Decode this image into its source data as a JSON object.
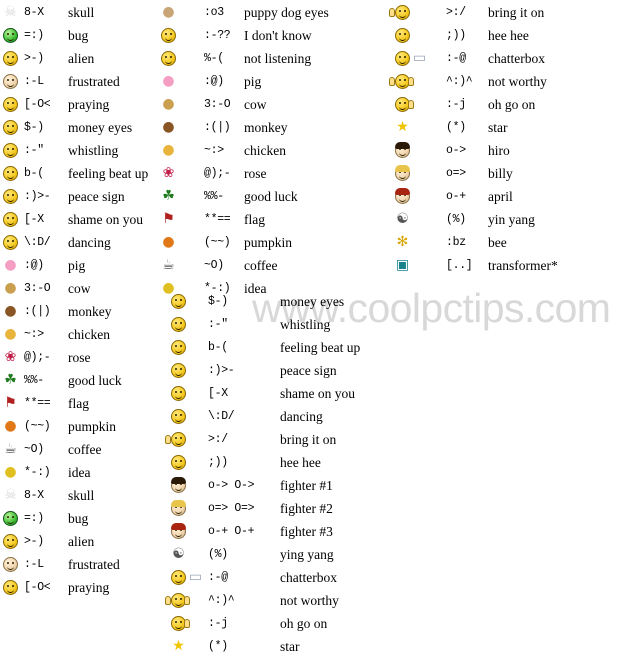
{
  "watermark": "www.coolpctips.com",
  "columns": {
    "a": {
      "name": "left-column",
      "rows": [
        {
          "icon": "skull-emoticon",
          "code": "8-X",
          "label": "skull"
        },
        {
          "icon": "bug-emoticon",
          "code": "=:)",
          "label": "bug"
        },
        {
          "icon": "alien-emoticon",
          "code": ">-)",
          "label": "alien"
        },
        {
          "icon": "frustrated-emoticon",
          "code": ":-L",
          "label": "frustrated"
        },
        {
          "icon": "praying-emoticon",
          "code": "[-O<",
          "label": "praying"
        },
        {
          "icon": "money-eyes-emoticon",
          "code": "$-)",
          "label": "money eyes"
        },
        {
          "icon": "whistling-emoticon",
          "code": ":-\"",
          "label": "whistling"
        },
        {
          "icon": "feeling-beat-up-emoticon",
          "code": "b-(",
          "label": "feeling beat up"
        },
        {
          "icon": "peace-sign-emoticon",
          "code": ":)>-",
          "label": "peace sign"
        },
        {
          "icon": "shame-on-you-emoticon",
          "code": "[-X",
          "label": "shame on you"
        },
        {
          "icon": "dancing-emoticon",
          "code": "\\:D/",
          "label": "dancing"
        },
        {
          "icon": "pig-emoticon",
          "code": ":@)",
          "label": "pig"
        },
        {
          "icon": "cow-emoticon",
          "code": "3:-O",
          "label": "cow"
        },
        {
          "icon": "monkey-emoticon",
          "code": ":(|)",
          "label": "monkey"
        },
        {
          "icon": "chicken-emoticon",
          "code": "~:>",
          "label": "chicken"
        },
        {
          "icon": "rose-emoticon",
          "code": "@);-",
          "label": "rose"
        },
        {
          "icon": "good-luck-emoticon",
          "code": "%%-",
          "label": "good luck"
        },
        {
          "icon": "flag-emoticon",
          "code": "**==",
          "label": "flag"
        },
        {
          "icon": "pumpkin-emoticon",
          "code": "(~~)",
          "label": "pumpkin"
        },
        {
          "icon": "coffee-emoticon",
          "code": "~O)",
          "label": "coffee"
        },
        {
          "icon": "idea-emoticon",
          "code": "*-:)",
          "label": "idea"
        },
        {
          "icon": "skull-emoticon",
          "code": "8-X",
          "label": "skull"
        },
        {
          "icon": "bug-emoticon",
          "code": "=:)",
          "label": "bug"
        },
        {
          "icon": "alien-emoticon",
          "code": ">-)",
          "label": "alien"
        },
        {
          "icon": "frustrated-emoticon",
          "code": ":-L",
          "label": "frustrated"
        },
        {
          "icon": "praying-emoticon",
          "code": "[-O<",
          "label": "praying"
        }
      ]
    },
    "b": {
      "name": "second-column",
      "rows": [
        {
          "icon": "puppy-dog-eyes-emoticon",
          "code": ":o3",
          "label": "puppy dog eyes"
        },
        {
          "icon": "i-dont-know-emoticon",
          "code": ":-??",
          "label": "I don't know"
        },
        {
          "icon": "not-listening-emoticon",
          "code": "%-(",
          "label": "not listening"
        },
        {
          "icon": "pig-emoticon",
          "code": ":@)",
          "label": "pig"
        },
        {
          "icon": "cow-emoticon",
          "code": "3:-O",
          "label": "cow"
        },
        {
          "icon": "monkey-emoticon",
          "code": ":(|)",
          "label": "monkey"
        },
        {
          "icon": "chicken-emoticon",
          "code": "~:>",
          "label": "chicken"
        },
        {
          "icon": "rose-emoticon",
          "code": "@);-",
          "label": "rose"
        },
        {
          "icon": "good-luck-emoticon",
          "code": "%%-",
          "label": "good luck"
        },
        {
          "icon": "flag-emoticon",
          "code": "**==",
          "label": "flag"
        },
        {
          "icon": "pumpkin-emoticon",
          "code": "(~~)",
          "label": "pumpkin"
        },
        {
          "icon": "coffee-emoticon",
          "code": "~O)",
          "label": "coffee"
        },
        {
          "icon": "idea-emoticon",
          "code": "*-:)",
          "label": "idea"
        }
      ]
    },
    "c": {
      "name": "third-column",
      "rows": [
        {
          "icon": "money-eyes-emoticon",
          "code": "$-)",
          "label": "money eyes"
        },
        {
          "icon": "whistling-emoticon",
          "code": ":-\"",
          "label": "whistling"
        },
        {
          "icon": "feeling-beat-up-emoticon",
          "code": "b-(",
          "label": "feeling beat up"
        },
        {
          "icon": "peace-sign-emoticon",
          "code": ":)>-",
          "label": "peace sign"
        },
        {
          "icon": "shame-on-you-emoticon",
          "code": "[-X",
          "label": "shame on you"
        },
        {
          "icon": "dancing-emoticon",
          "code": "\\:D/",
          "label": "dancing"
        },
        {
          "icon": "bring-it-on-emoticon",
          "code": ">:/",
          "label": "bring it on"
        },
        {
          "icon": "hee-hee-emoticon",
          "code": ";))",
          "label": "hee hee"
        },
        {
          "icon": "fighter-1-emoticon",
          "code": "o-> O->",
          "label": "fighter #1"
        },
        {
          "icon": "fighter-2-emoticon",
          "code": "o=> O=>",
          "label": "fighter #2"
        },
        {
          "icon": "fighter-3-emoticon",
          "code": "o-+ O-+",
          "label": "fighter #3"
        },
        {
          "icon": "ying-yang-emoticon",
          "code": "(%)",
          "label": "ying yang"
        },
        {
          "icon": "chatterbox-emoticon",
          "code": ":-@",
          "label": "chatterbox"
        },
        {
          "icon": "not-worthy-emoticon",
          "code": "^:)^",
          "label": "not worthy"
        },
        {
          "icon": "oh-go-on-emoticon",
          "code": ":-j",
          "label": "oh go on"
        },
        {
          "icon": "star-emoticon",
          "code": "(*)",
          "label": "star"
        }
      ]
    },
    "d": {
      "name": "right-column",
      "rows": [
        {
          "icon": "bring-it-on-emoticon",
          "code": ">:/",
          "label": "bring it on"
        },
        {
          "icon": "hee-hee-emoticon",
          "code": ";))",
          "label": "hee hee"
        },
        {
          "icon": "chatterbox-emoticon",
          "code": ":-@",
          "label": "chatterbox"
        },
        {
          "icon": "not-worthy-emoticon",
          "code": "^:)^",
          "label": "not worthy"
        },
        {
          "icon": "oh-go-on-emoticon",
          "code": ":-j",
          "label": "oh go on"
        },
        {
          "icon": "star-emoticon",
          "code": "(*)",
          "label": "star"
        },
        {
          "icon": "hiro-emoticon",
          "code": "o->",
          "label": "hiro"
        },
        {
          "icon": "billy-emoticon",
          "code": "o=>",
          "label": "billy"
        },
        {
          "icon": "april-emoticon",
          "code": "o-+",
          "label": "april"
        },
        {
          "icon": "yin-yang-emoticon",
          "code": "(%)",
          "label": "yin yang"
        },
        {
          "icon": "bee-emoticon",
          "code": ":bz",
          "label": "bee"
        },
        {
          "icon": "transformer-emoticon",
          "code": "[..]",
          "label": "transformer*"
        }
      ]
    }
  }
}
